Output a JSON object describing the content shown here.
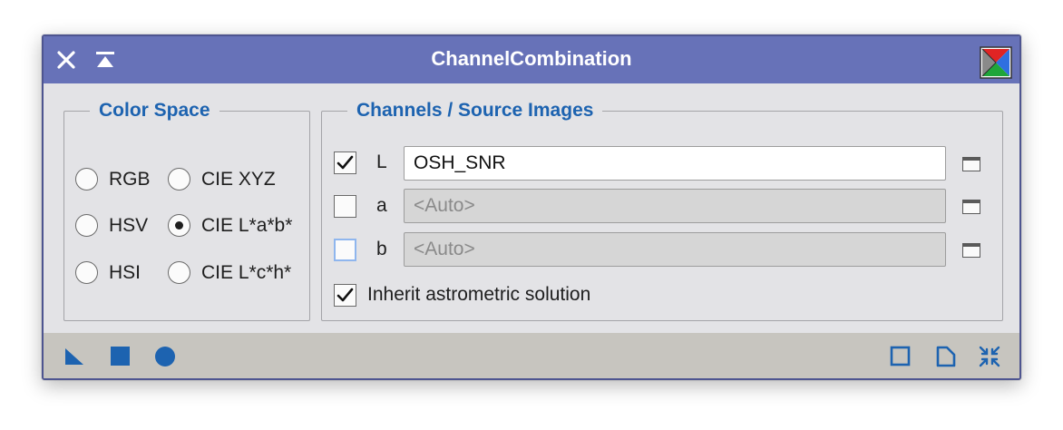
{
  "window": {
    "title": "ChannelCombination"
  },
  "color_space": {
    "title": "Color Space",
    "options": [
      {
        "label": "RGB",
        "checked": false
      },
      {
        "label": "CIE XYZ",
        "checked": false
      },
      {
        "label": "HSV",
        "checked": false
      },
      {
        "label": "CIE L*a*b*",
        "checked": true
      },
      {
        "label": "HSI",
        "checked": false
      },
      {
        "label": "CIE L*c*h*",
        "checked": false
      }
    ]
  },
  "channels": {
    "title": "Channels / Source Images",
    "rows": [
      {
        "channel": "L",
        "enabled": true,
        "value": "OSH_SNR",
        "placeholder": ""
      },
      {
        "channel": "a",
        "enabled": false,
        "value": "",
        "placeholder": "<Auto>"
      },
      {
        "channel": "b",
        "enabled": false,
        "value": "",
        "placeholder": "<Auto>"
      }
    ],
    "inherit_label": "Inherit astrometric solution",
    "inherit_checked": true
  },
  "colors": {
    "titlebar": "#6772b8",
    "accent": "#1d63b0",
    "bottombar": "#c7c5bf"
  },
  "icons": {
    "titlebar": [
      "close-icon",
      "shade-icon",
      "channels-logo-icon"
    ],
    "bottom_left": [
      "new-instance-icon",
      "apply-icon",
      "apply-global-icon"
    ],
    "bottom_right": [
      "preview-icon",
      "reset-icon",
      "collapse-icon"
    ]
  }
}
